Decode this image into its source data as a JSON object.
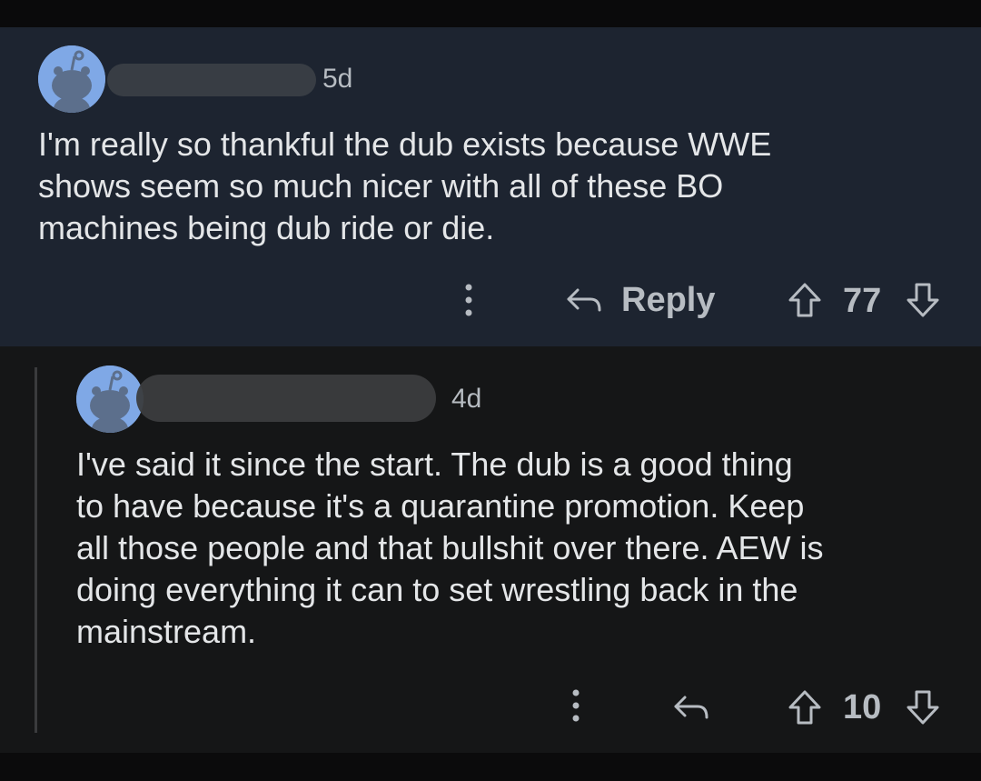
{
  "comments": [
    {
      "username": "",
      "age": "5d",
      "text": "I'm really so thankful the dub exists because WWE\nshows seem so much nicer with all of these BO\nmachines being dub ride or die.",
      "actions": {
        "reply_label": "Reply",
        "score": "77"
      }
    },
    {
      "username": "",
      "age": "4d",
      "text": "I've said it since the start.  The dub is a good thing\nto have because it's a quarantine promotion.  Keep\nall those people and that bullshit over there.  AEW is\ndoing everything it can to set wrestling back in the\nmainstream.",
      "actions": {
        "reply_label": "",
        "score": "10"
      }
    }
  ],
  "icons": [
    "snoo-avatar-icon",
    "more-options-icon",
    "reply-icon",
    "upvote-icon",
    "downvote-icon"
  ],
  "colors": {
    "accent_avatar": "#7fa8e6",
    "top_comment_bg": "#1d2430",
    "reply_bg": "#151617"
  }
}
